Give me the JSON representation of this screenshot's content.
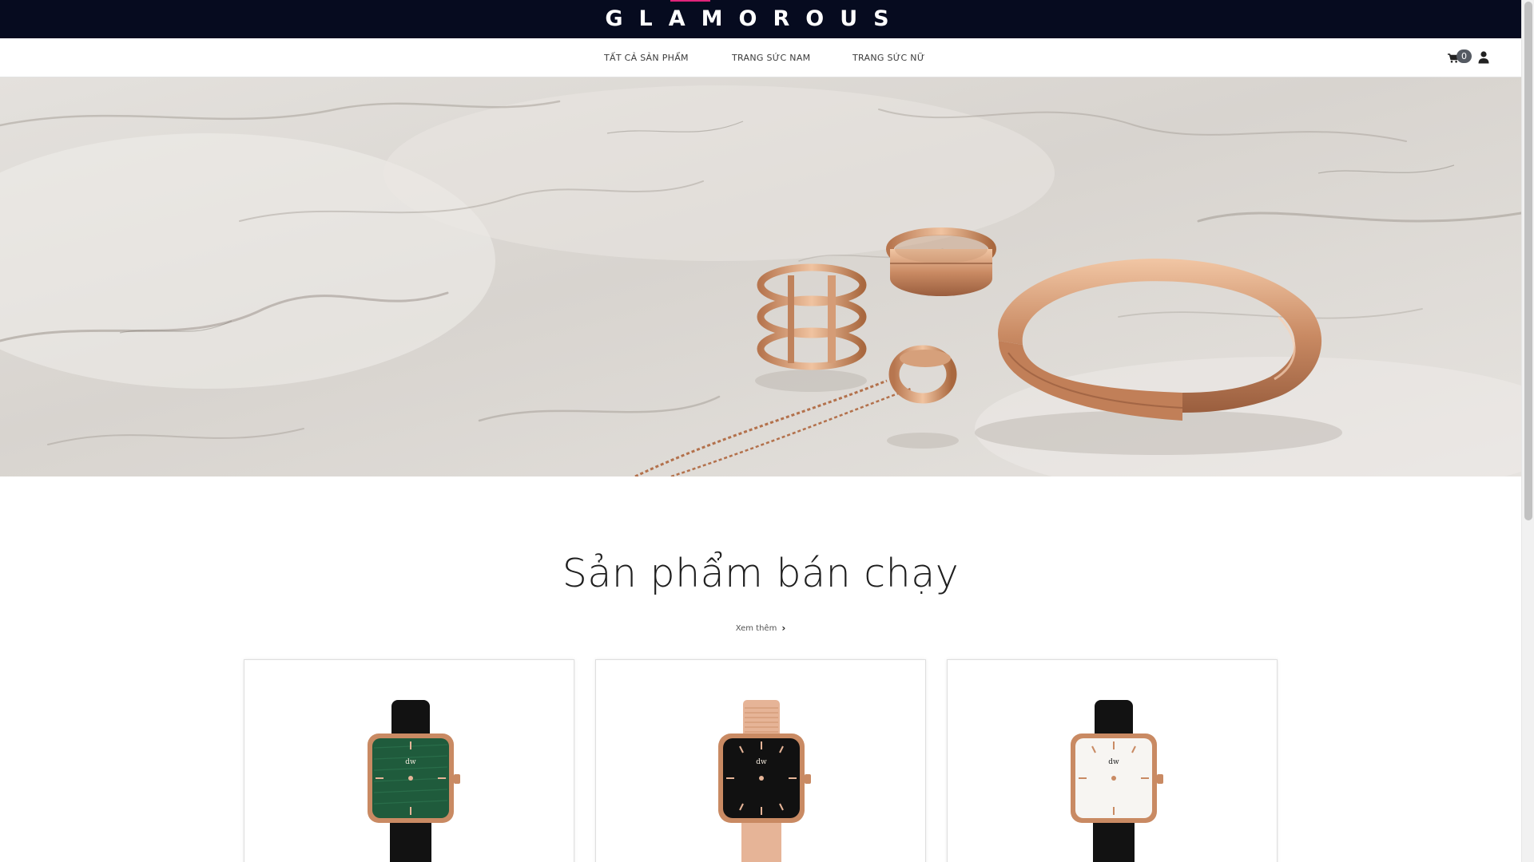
{
  "brand": {
    "logo_text": "GLAMOROUS"
  },
  "nav": {
    "items": [
      {
        "label": "TẤT CẢ SẢN PHẨM"
      },
      {
        "label": "TRANG SỨC NAM"
      },
      {
        "label": "TRANG SỨC NỮ"
      }
    ],
    "cart_count": "0",
    "icons": {
      "cart": "shopping-cart-icon",
      "user": "user-icon"
    }
  },
  "hero": {
    "image": "rose-gold-jewelry-on-marble"
  },
  "bestsellers": {
    "title": "Sản phẩm bán chạy",
    "see_more_label": "Xem thêm",
    "products": [
      {
        "image": "watch-green-dial-black-strap",
        "dial_color": "#1f5b3c",
        "strap_color": "#111111"
      },
      {
        "image": "watch-black-dial-mesh-band",
        "dial_color": "#111111",
        "strap_color": "#e6b497"
      },
      {
        "image": "watch-white-dial-black-strap",
        "dial_color": "#f7f5f2",
        "strap_color": "#111111"
      }
    ]
  },
  "colors": {
    "header_bg": "#060b1f",
    "accent": "#e0247a",
    "rose_gold": "#c98a63"
  }
}
